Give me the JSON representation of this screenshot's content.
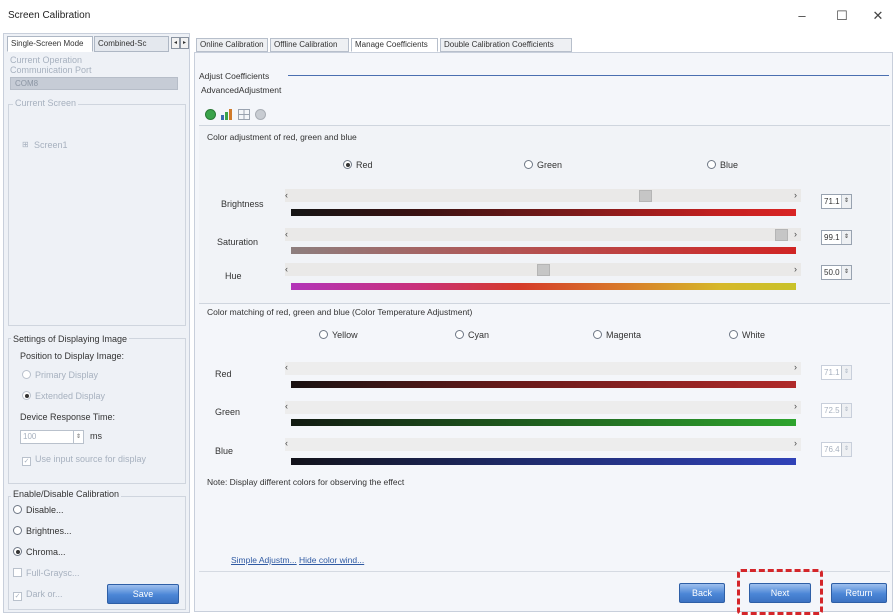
{
  "window": {
    "title": "Screen Calibration",
    "minimize": "–",
    "maximize": "☐",
    "close": "✕"
  },
  "left_panel": {
    "tabs": [
      "Single-Screen Mode",
      "Combined-Sc"
    ],
    "current_operation": {
      "label": "Current Operation",
      "port_label": "Communication Port",
      "port_value": "COM8"
    },
    "current_screen": {
      "label": "Current Screen",
      "tree_item": "Screen1"
    },
    "display_settings": {
      "title": "Settings of Displaying Image",
      "position_label": "Position to Display Image:",
      "options": [
        "Primary Display",
        "Extended Display"
      ],
      "response_time_label": "Device Response Time:",
      "response_time_value": "100",
      "response_time_unit": "ms",
      "input_source_label": "Use input source for display"
    },
    "calibration": {
      "title": "Enable/Disable Calibration",
      "options": [
        "Disable...",
        "Brightnes...",
        "Chroma...",
        "Full-Graysc...",
        "Dark or..."
      ],
      "save_label": "Save"
    }
  },
  "tabs": [
    "Online Calibration",
    "Offline Calibration",
    "Manage Coefficients",
    "Double Calibration Coefficients"
  ],
  "adjust": {
    "title": "Adjust Coefficients",
    "subtitle": "AdvancedAdjustment",
    "toolbar_icons": [
      "refresh-icon",
      "chart-icon",
      "grid-icon",
      "clear-icon"
    ]
  },
  "color_adjust": {
    "title": "Color adjustment of red, green and blue",
    "radios": [
      "Red",
      "Green",
      "Blue"
    ],
    "selected": "Red",
    "sliders": [
      {
        "label": "Brightness",
        "value": "71.1",
        "level": 0.71
      },
      {
        "label": "Saturation",
        "value": "99.1",
        "level": 0.99
      },
      {
        "label": "Hue",
        "value": "50.0",
        "level": 0.5
      }
    ]
  },
  "color_match": {
    "title": "Color matching of red, green and blue (Color Temperature Adjustment)",
    "radios": [
      "Yellow",
      "Cyan",
      "Magenta",
      "White"
    ],
    "sliders": [
      {
        "label": "Red",
        "value": "71.1"
      },
      {
        "label": "Green",
        "value": "72.5"
      },
      {
        "label": "Blue",
        "value": "76.4"
      }
    ],
    "note": "Note: Display different colors for observing the effect"
  },
  "links": {
    "simple": "Simple Adjustm...",
    "hide": "Hide color wind..."
  },
  "footer_buttons": {
    "back": "Back",
    "next": "Next",
    "return": "Return"
  },
  "colors": {
    "accent_button": "#4b86d6",
    "highlight": "#d4262a"
  }
}
